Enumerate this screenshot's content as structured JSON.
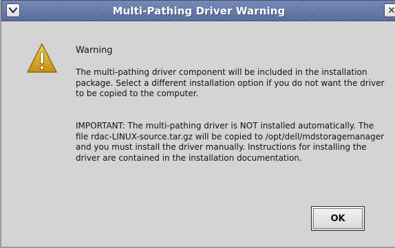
{
  "window": {
    "title": "Multi-Pathing Driver Warning",
    "menu_icon": "chevron-down-icon",
    "close_icon": "close-icon",
    "close_glyph": "×"
  },
  "content": {
    "icon": "warning-icon",
    "icon_color": "#d9a51e",
    "heading": "Warning",
    "paragraphs": [
      "The multi-pathing driver component will be included in the installation package.  Select a different installation option if you do not want the driver to be copied to the computer.",
      "IMPORTANT: The multi-pathing driver is NOT installed automatically.  The file rdac-LINUX-source.tar.gz will be copied to /opt/dell/mdstoragemanager and you must install the driver manually.  Instructions for installing the driver are contained in the installation documentation."
    ]
  },
  "buttons": {
    "ok_label": "OK"
  }
}
